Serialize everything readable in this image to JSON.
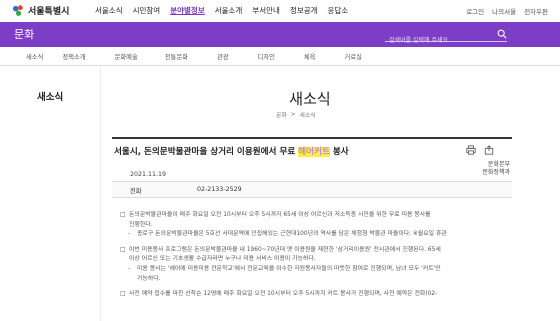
{
  "brand": {
    "name": "서울특별시",
    "colors": {
      "purple": "#7d3ec7",
      "highlight": "#ffee3a",
      "highlight_text": "#c08ae6"
    }
  },
  "gnb": {
    "items": [
      "서울소식",
      "시민참여",
      "분야별정보",
      "서울소개",
      "부서안내",
      "정보공개",
      "응답소"
    ],
    "active": "분야별정보"
  },
  "util": {
    "items": [
      "로그인",
      "나의서울",
      "전자우편"
    ]
  },
  "hero": {
    "title": "문화",
    "search_placeholder": "검색어를 입력해 주세요",
    "search_icon": "search-icon"
  },
  "subnav": {
    "items": [
      "새소식",
      "정책소개",
      "문화예술",
      "전통문화",
      "관광",
      "디자인",
      "체육",
      "거료실"
    ]
  },
  "sidebar": {
    "title": "새소식"
  },
  "page": {
    "title": "새소식",
    "breadcrumb": [
      "문화",
      ">",
      "새소식"
    ]
  },
  "article": {
    "title_before": "서울시, 돈의문박물관마을 상거리 이용원에서 무료 ",
    "title_highlight": "헤어커트",
    "title_after": " 봉사",
    "date": "2021.11.19",
    "dept": [
      "문화본부",
      "문화정책과"
    ],
    "phone_label": "전화",
    "phone_value": "02-2133-2529",
    "icons": [
      "print-icon",
      "share-icon"
    ]
  },
  "body": [
    {
      "level": 1,
      "bullet": "□",
      "text": "돈의문박물관마을이 매주 화요일 오전 10시부터 오후 5시까지 65세 이상 어르신과 저소득층 시민을 위한 무료 미용 봉사를"
    },
    {
      "level": 1,
      "bullet": "",
      "text": "진행한다."
    },
    {
      "level": 2,
      "bullet": "-",
      "text": "종로구 돈의문박물관마을은 5호선 서대문역에 인접해있는 근현대100년의 역사를 담은 체험형 박물관 마을이다. ※월요일 휴관"
    },
    {
      "level": 0
    },
    {
      "level": 1,
      "bullet": "□",
      "text": "이번 미용봉사 프로그램은 돈의문박물관마을 내 1960~70년대 옛 이용원을 재현한 '삼거리이용원' 전시관에서 진행된다. 65세"
    },
    {
      "level": 1,
      "bullet": "",
      "text": "이상 어르신 또는 기초생활 수급자라면 누구나 미용 서비스 이용이 가능하다."
    },
    {
      "level": 2,
      "bullet": "-",
      "text": "미용 봉사는 '헤어애 미용미용 전문학교'에서 전문교육을 이수한 자원봉사자들의 따뜻한 참여로 진행되며, 남녀 모두 '커트'만"
    },
    {
      "level": 2,
      "bullet": "",
      "text": "가능하다."
    },
    {
      "level": 0
    },
    {
      "level": 1,
      "bullet": "□",
      "text": "사전 예약 접수를 마친 선착순 12명에 매주 화요일 오전 10시부터 오후 5시까지 커트 봉사가 진행되며, 사전 예약은 전화(02-"
    }
  ]
}
